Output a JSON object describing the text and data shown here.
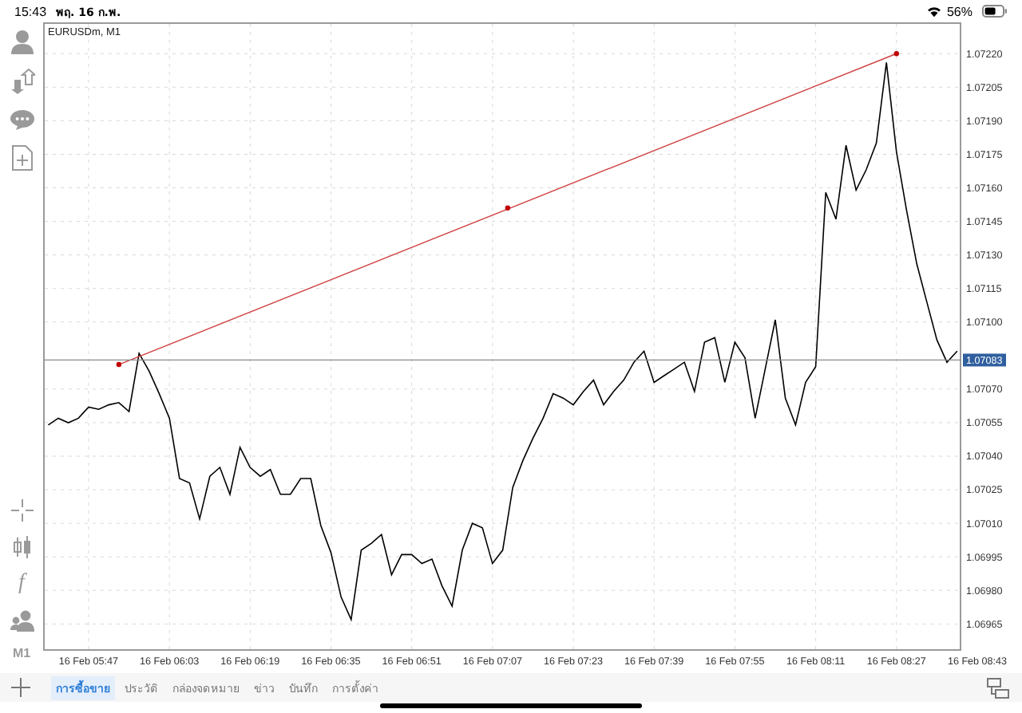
{
  "status_bar": {
    "time": "15:43",
    "date": "พฤ. 16 ก.พ.",
    "battery": "56%"
  },
  "chart": {
    "title": "EURUSDm, M1",
    "current_price": "1.07083",
    "chart_data": {
      "type": "line",
      "grid": true,
      "ylim": [
        1.06953,
        1.07234
      ],
      "categories": [
        null,
        null,
        null,
        null,
        "16 Feb 05:47",
        null,
        null,
        null,
        null,
        null,
        null,
        null,
        "16 Feb 06:03",
        null,
        null,
        null,
        null,
        null,
        null,
        null,
        "16 Feb 06:19",
        null,
        null,
        null,
        null,
        null,
        null,
        null,
        "16 Feb 06:35",
        null,
        null,
        null,
        null,
        null,
        null,
        null,
        "16 Feb 06:51",
        null,
        null,
        null,
        null,
        null,
        null,
        null,
        "16 Feb 07:07",
        null,
        null,
        null,
        null,
        null,
        null,
        null,
        "16 Feb 07:23",
        null,
        null,
        null,
        null,
        null,
        null,
        null,
        "16 Feb 07:39",
        null,
        null,
        null,
        null,
        null,
        null,
        null,
        "16 Feb 07:55",
        null,
        null,
        null,
        null,
        null,
        null,
        null,
        "16 Feb 08:11",
        null,
        null,
        null,
        null,
        null,
        null,
        null,
        "16 Feb 08:27",
        null,
        null,
        null,
        null,
        null,
        null,
        null,
        "16 Feb 08:43"
      ],
      "series": [
        {
          "color": "#000000",
          "values": [
            1.07054,
            1.07057,
            1.07055,
            1.07057,
            1.07062,
            1.07061,
            1.07063,
            1.07064,
            1.0706,
            1.07086,
            1.07078,
            1.07068,
            1.07057,
            1.0703,
            1.07028,
            1.07012,
            1.07031,
            1.07035,
            1.07023,
            1.07044,
            1.07035,
            1.07031,
            1.07034,
            1.07023,
            1.07023,
            1.0703,
            1.0703,
            1.07009,
            1.06997,
            1.06977,
            1.06967,
            1.06998,
            1.07001,
            1.07005,
            1.06987,
            1.06996,
            1.06996,
            1.06992,
            1.06994,
            1.06982,
            1.06973,
            1.06998,
            1.0701,
            1.07008,
            1.06992,
            1.06998,
            1.07026,
            1.07038,
            1.07048,
            1.07057,
            1.07068,
            1.07066,
            1.07063,
            1.07069,
            1.07074,
            1.07063,
            1.07069,
            1.07074,
            1.07082,
            1.07087,
            1.07073,
            1.07076,
            1.07079,
            1.07082,
            1.07069,
            1.07091,
            1.07093,
            1.07073,
            1.07091,
            1.07084,
            1.07057,
            1.07079,
            1.07101,
            1.07066,
            1.07054,
            1.07073,
            1.0708,
            1.07158,
            1.07146,
            1.07179,
            1.07159,
            1.07168,
            1.0718,
            1.07216,
            1.07176,
            1.0715,
            1.07126,
            1.07109,
            1.07092,
            1.07082,
            1.07087,
            null,
            null
          ]
        }
      ],
      "yticks": [
        {
          "value": 1.0722,
          "label": "1.07220"
        },
        {
          "value": 1.07205,
          "label": "1.07205"
        },
        {
          "value": 1.0719,
          "label": "1.07190"
        },
        {
          "value": 1.07175,
          "label": "1.07175"
        },
        {
          "value": 1.0716,
          "label": "1.07160"
        },
        {
          "value": 1.07145,
          "label": "1.07145"
        },
        {
          "value": 1.0713,
          "label": "1.07130"
        },
        {
          "value": 1.07115,
          "label": "1.07115"
        },
        {
          "value": 1.071,
          "label": "1.07100"
        },
        {
          "value": 1.0707,
          "label": "1.07070"
        },
        {
          "value": 1.07055,
          "label": "1.07055"
        },
        {
          "value": 1.0704,
          "label": "1.07040"
        },
        {
          "value": 1.07025,
          "label": "1.07025"
        },
        {
          "value": 1.0701,
          "label": "1.07010"
        },
        {
          "value": 1.06995,
          "label": "1.06995"
        },
        {
          "value": 1.0698,
          "label": "1.06980"
        },
        {
          "value": 1.06965,
          "label": "1.06965"
        }
      ]
    }
  },
  "toolbar": {
    "indicator_symbol": "f",
    "timeframe": "M1"
  },
  "tabs": [
    {
      "label": "การซื้อขาย",
      "selected": true
    },
    {
      "label": "ประวัติ",
      "selected": false
    },
    {
      "label": "กล่องจดหมาย",
      "selected": false
    },
    {
      "label": "ข่าว",
      "selected": false
    },
    {
      "label": "บันทึก",
      "selected": false
    },
    {
      "label": "การตั้งค่า",
      "selected": false
    }
  ]
}
